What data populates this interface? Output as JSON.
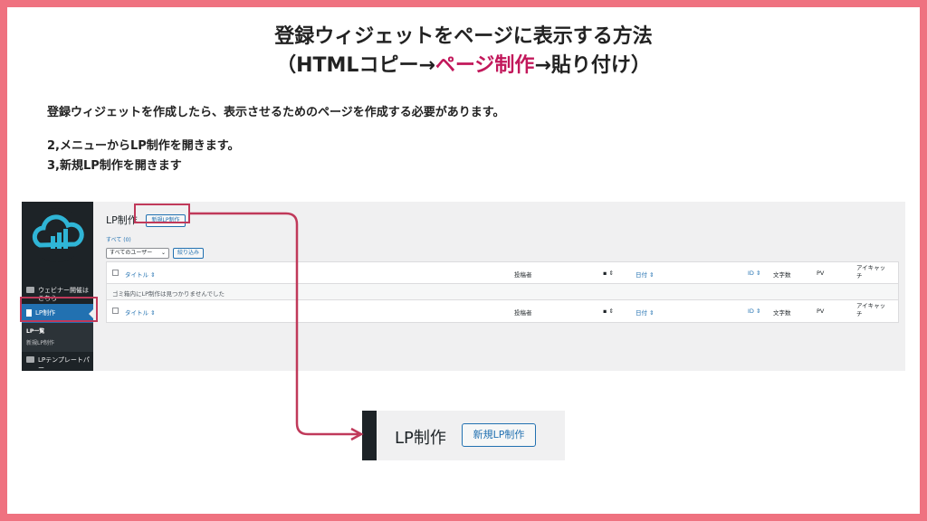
{
  "title": {
    "line1": "登録ウィジェットをページに表示する方法",
    "line2_pre": "（HTMLコピー→",
    "line2_accent": "ページ制作",
    "line2_post": "→貼り付け）"
  },
  "description": {
    "intro": "登録ウィジェットを作成したら、表示させるためのページを作成する必要があります。",
    "step2": "2,メニューからLP制作を開きます。",
    "step3": "3,新規LP制作を開きます"
  },
  "sidebar": {
    "item_webinar": "ウェビナー開催は\nこちら",
    "item_lp": "LP制作",
    "sub_list": "LP一覧",
    "sub_new": "新規LP制作",
    "item_template": "LPテンプレートパー\nツ"
  },
  "main": {
    "heading": "LP制作",
    "new_button": "新規LP制作",
    "filter_all": "すべて (0)",
    "user_select": "すべてのユーザー",
    "filter_button": "絞り込み",
    "columns": {
      "title": "タイトル",
      "author": "投稿者",
      "date": "日付",
      "id": "ID",
      "chars": "文字数",
      "pv": "PV",
      "eyecatch": "アイキャッ\nチ"
    },
    "empty_message": "ゴミ箱内にLP制作は見つかりませんでした"
  },
  "zoom": {
    "heading": "LP制作",
    "new_button": "新規LP制作"
  },
  "colors": {
    "frame": "#ef7280",
    "accent": "#c2185b",
    "highlight": "#c0395a",
    "wp_blue": "#2271b1",
    "wp_dark": "#1d2327"
  }
}
